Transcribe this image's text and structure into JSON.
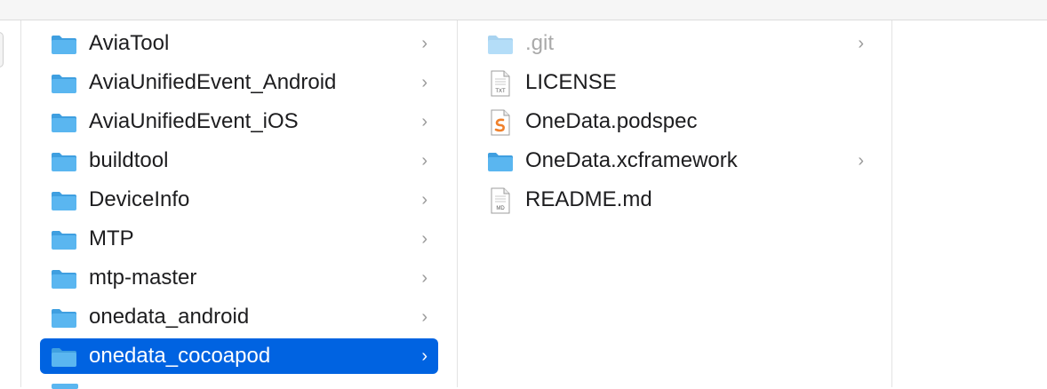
{
  "colors": {
    "selection": "#0063e1",
    "folder_body": "#5ab6f0",
    "folder_tab": "#3f9fe0",
    "swift_orange": "#f0812c"
  },
  "columns": [
    {
      "items": [
        {
          "label": "AviaTool",
          "icon": "folder-icon",
          "has_children": true,
          "chevron": "›"
        },
        {
          "label": "AviaUnifiedEvent_Android",
          "icon": "folder-icon",
          "has_children": true,
          "chevron": "›"
        },
        {
          "label": "AviaUnifiedEvent_iOS",
          "icon": "folder-icon",
          "has_children": true,
          "chevron": "›"
        },
        {
          "label": "buildtool",
          "icon": "folder-icon",
          "has_children": true,
          "chevron": "›"
        },
        {
          "label": "DeviceInfo",
          "icon": "folder-icon",
          "has_children": true,
          "chevron": "›"
        },
        {
          "label": "MTP",
          "icon": "folder-icon",
          "has_children": true,
          "chevron": "›"
        },
        {
          "label": "mtp-master",
          "icon": "folder-icon",
          "has_children": true,
          "chevron": "›"
        },
        {
          "label": "onedata_android",
          "icon": "folder-icon",
          "has_children": true,
          "chevron": "›"
        },
        {
          "label": "onedata_cocoapod",
          "icon": "folder-icon",
          "has_children": true,
          "chevron": "›",
          "selected": true
        }
      ]
    },
    {
      "items": [
        {
          "label": ".git",
          "icon": "folder-icon",
          "has_children": true,
          "chevron": "›",
          "dimmed": true
        },
        {
          "label": "LICENSE",
          "icon": "text-file-icon",
          "badge": "TXT"
        },
        {
          "label": "OneData.podspec",
          "icon": "swift-file-icon"
        },
        {
          "label": "OneData.xcframework",
          "icon": "folder-icon",
          "has_children": true,
          "chevron": "›"
        },
        {
          "label": "README.md",
          "icon": "markdown-file-icon",
          "badge": "MD"
        }
      ]
    }
  ]
}
